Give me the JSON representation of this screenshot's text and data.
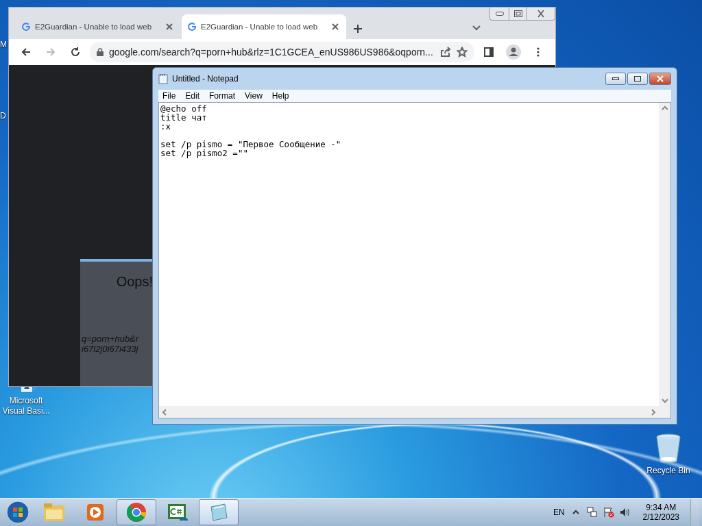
{
  "desktop": {
    "edge_labels": [
      "M",
      "D"
    ],
    "icons": [
      {
        "kind": "visual-basic",
        "label": "Microsoft Visual Basi..."
      },
      {
        "kind": "recycle-bin",
        "label": "Recycle Bin"
      }
    ]
  },
  "browser": {
    "tabs": [
      {
        "title": "E2Guardian - Unable to load web",
        "selected": false
      },
      {
        "title": "E2Guardian - Unable to load web",
        "selected": true
      }
    ],
    "address": "google.com/search?q=porn+hub&rlz=1C1GCEA_enUS986US986&oqporn...",
    "page": {
      "heading": "Oops!",
      "lines": [
        "q=porn+hub&r",
        "i67l2j0i67i433j"
      ]
    }
  },
  "notepad": {
    "title": "Untitled - Notepad",
    "menu": [
      "File",
      "Edit",
      "Format",
      "View",
      "Help"
    ],
    "text": "@echo off\ntitle чат\n:x\n\nset /p pismo = \"Первое Сообщение -\"\nset /p pismo2 =\"\""
  },
  "taskbar": {
    "apps": [
      {
        "kind": "explorer",
        "open": false,
        "selected": false
      },
      {
        "kind": "media",
        "open": false,
        "selected": false
      },
      {
        "kind": "chrome",
        "open": true,
        "selected": false
      },
      {
        "kind": "csharp",
        "open": false,
        "selected": false
      },
      {
        "kind": "notepad",
        "open": true,
        "selected": true
      }
    ],
    "language": "EN",
    "time": "9:34 AM",
    "date": "2/12/2023"
  }
}
